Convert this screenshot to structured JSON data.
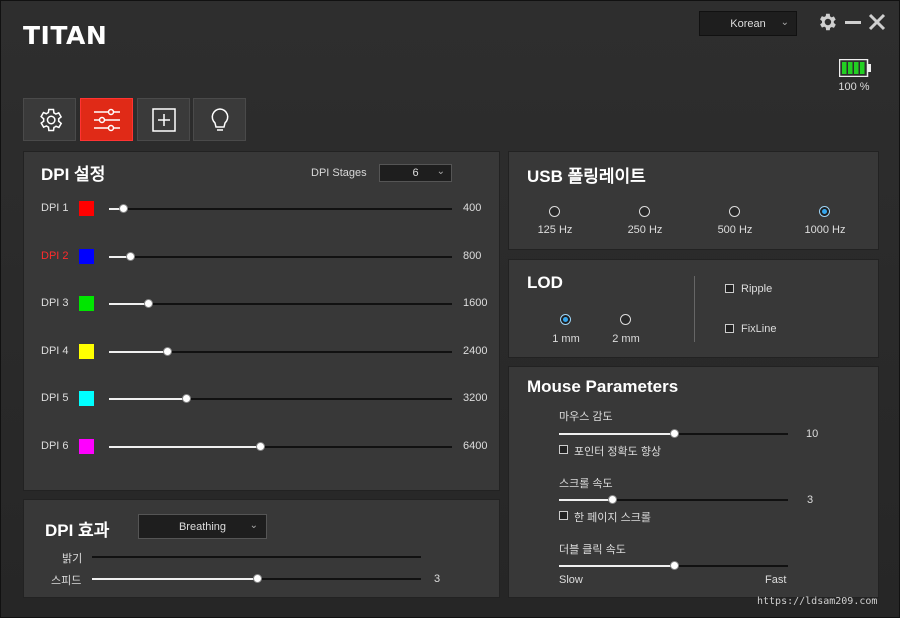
{
  "app": {
    "logo": "TITAN",
    "language": "Korean",
    "battery": "100 %"
  },
  "tabs": [
    {
      "name": "tab-settings",
      "icon": "gear-icon"
    },
    {
      "name": "tab-dpi",
      "icon": "sliders-icon"
    },
    {
      "name": "tab-macro",
      "icon": "plus-box-icon"
    },
    {
      "name": "tab-lighting",
      "icon": "bulb-icon"
    }
  ],
  "dpi": {
    "title": "DPI 설정",
    "stages_label": "DPI Stages",
    "stages_value": "6",
    "rows": [
      {
        "label": "DPI 1",
        "color": "#ff0000",
        "value": "400",
        "pos": 0.04,
        "active": false
      },
      {
        "label": "DPI 2",
        "color": "#0000ff",
        "value": "800",
        "pos": 0.06,
        "active": true
      },
      {
        "label": "DPI 3",
        "color": "#00e600",
        "value": "1600",
        "pos": 0.115,
        "active": false
      },
      {
        "label": "DPI 4",
        "color": "#ffff00",
        "value": "2400",
        "pos": 0.17,
        "active": false
      },
      {
        "label": "DPI 5",
        "color": "#00ffff",
        "value": "3200",
        "pos": 0.225,
        "active": false
      },
      {
        "label": "DPI 6",
        "color": "#ff00ff",
        "value": "6400",
        "pos": 0.44,
        "active": false
      }
    ]
  },
  "effect": {
    "title": "DPI 효과",
    "mode": "Breathing",
    "brightness_label": "밝기",
    "speed_label": "스피드",
    "speed_value": "3",
    "speed_pos": 0.5
  },
  "usb": {
    "title": "USB 폴링레이트",
    "options": [
      {
        "label": "125 Hz",
        "selected": false
      },
      {
        "label": "250 Hz",
        "selected": false
      },
      {
        "label": "500 Hz",
        "selected": false
      },
      {
        "label": "1000 Hz",
        "selected": true
      }
    ]
  },
  "lod": {
    "title": "LOD",
    "options": [
      {
        "label": "1 mm",
        "selected": true
      },
      {
        "label": "2 mm",
        "selected": false
      }
    ],
    "ripple": "Ripple",
    "fixline": "FixLine"
  },
  "mouse": {
    "title": "Mouse Parameters",
    "sensitivity_label": "마우스 감도",
    "sensitivity_value": "10",
    "sensitivity_pos": 0.5,
    "precision_label": "포인터 정확도 향상",
    "scroll_label": "스크롤 속도",
    "scroll_value": "3",
    "scroll_pos": 0.23,
    "page_scroll_label": "한 페이지 스크롤",
    "dblclick_label": "더블 클릭 속도",
    "dblclick_pos": 0.5,
    "slow": "Slow",
    "fast": "Fast"
  },
  "watermark": "https://ldsam209.com"
}
